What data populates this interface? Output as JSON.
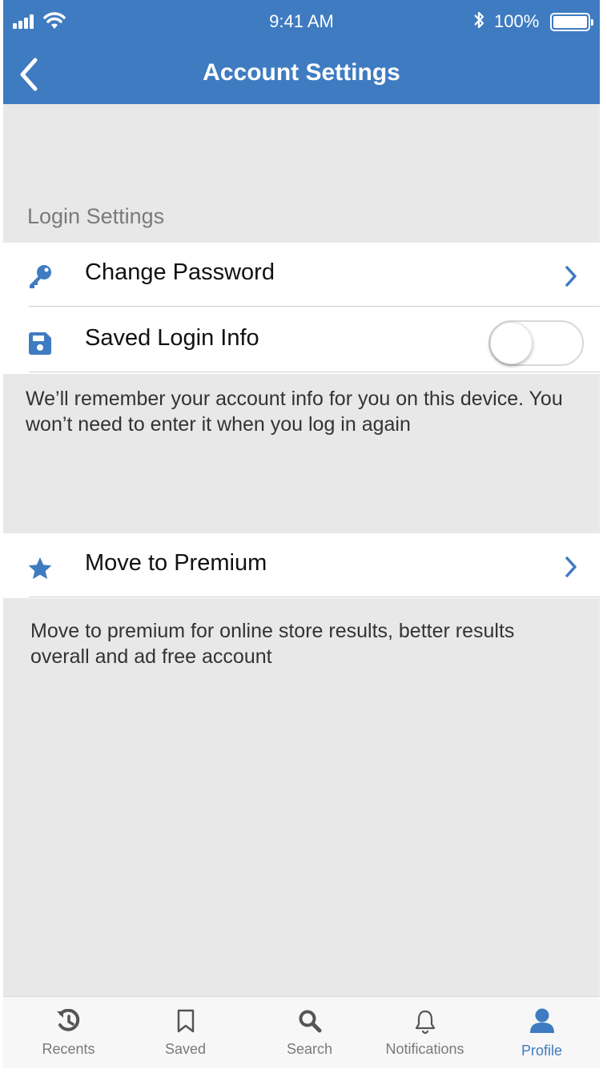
{
  "status_bar": {
    "time": "9:41 AM",
    "battery": "100%"
  },
  "header": {
    "title": "Account Settings"
  },
  "login_settings": {
    "section_label": "Login Settings",
    "change_password_label": "Change Password",
    "saved_login_label": "Saved Login Info",
    "saved_login_enabled": false,
    "note": "We’ll remember your account info for you on this device. You won’t need to enter it when you log in again"
  },
  "premium": {
    "label": "Move to Premium",
    "note": "Move to premium for online store results, better results overall and ad free account"
  },
  "tabbar": {
    "tabs": [
      {
        "label": "Recents",
        "icon": "history-icon"
      },
      {
        "label": "Saved",
        "icon": "bookmark-icon"
      },
      {
        "label": "Search",
        "icon": "search-icon"
      },
      {
        "label": "Notifications",
        "icon": "bell-icon"
      },
      {
        "label": "Profile",
        "icon": "user-icon"
      }
    ],
    "active": "Profile"
  },
  "colors": {
    "accent": "#3f7bc1",
    "background": "#e8e8e8"
  }
}
